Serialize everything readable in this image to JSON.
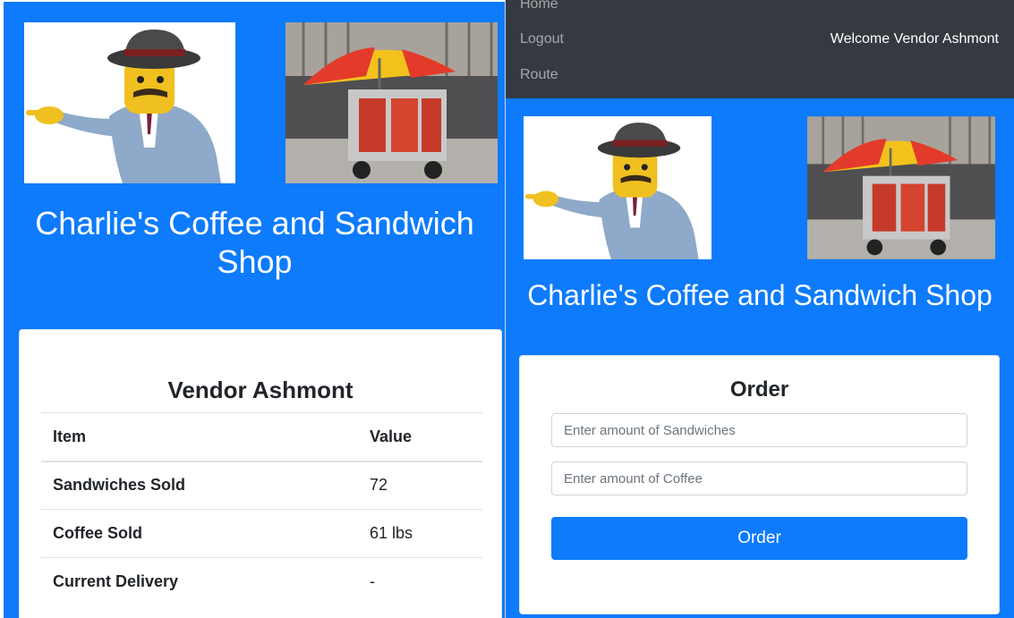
{
  "left": {
    "shop_title": "Charlie's Coffee and Sandwich Shop",
    "vendor_title": "Vendor Ashmont",
    "table": {
      "headers": [
        "Item",
        "Value"
      ],
      "rows": [
        {
          "item": "Sandwiches Sold",
          "value": "72"
        },
        {
          "item": "Coffee Sold",
          "value": "61 lbs"
        },
        {
          "item": "Current Delivery",
          "value": "-"
        }
      ]
    }
  },
  "right": {
    "nav": {
      "home": "Home",
      "logout": "Logout",
      "route": "Route",
      "welcome": "Welcome Vendor Ashmont"
    },
    "shop_title": "Charlie's Coffee and Sandwich Shop",
    "order": {
      "title": "Order",
      "sandwich_placeholder": "Enter amount of Sandwiches",
      "coffee_placeholder": "Enter amount of Coffee",
      "button_label": "Order"
    }
  },
  "colors": {
    "brand_blue": "#0d7bfb",
    "navbar": "#343a40"
  },
  "icons": {
    "chef": "mascot-illustration",
    "cart": "hot-dog-cart-photo"
  }
}
